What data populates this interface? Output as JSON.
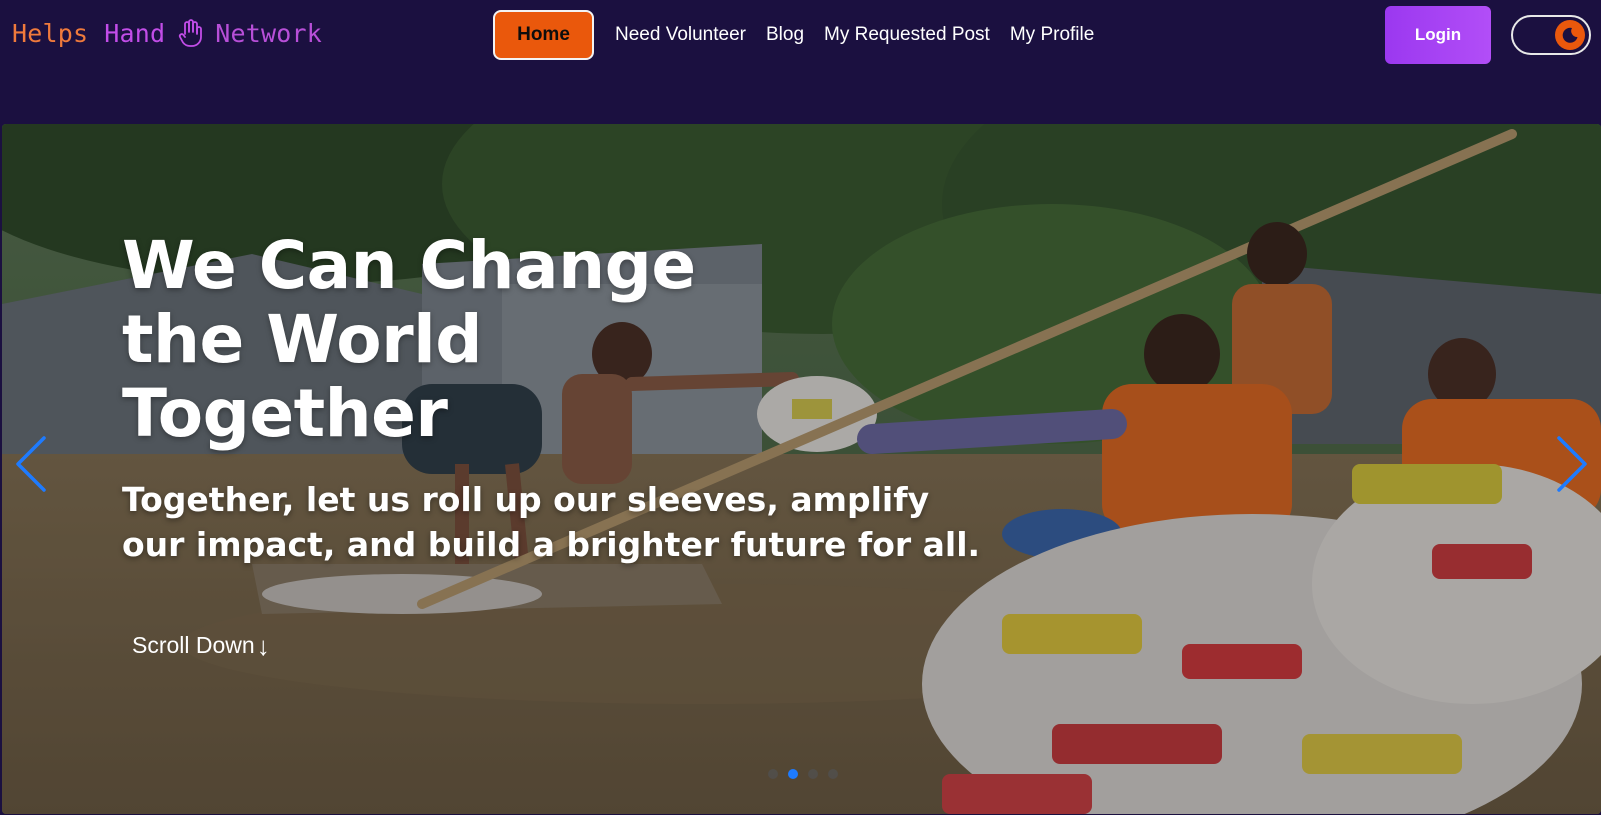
{
  "brand": {
    "word1": "Helps",
    "word2": "Hand",
    "word3": "Network",
    "icon": "hand-icon"
  },
  "nav": {
    "home": "Home",
    "links": [
      "Need Volunteer",
      "Blog",
      "My Requested Post",
      "My Profile"
    ]
  },
  "login": "Login",
  "theme_toggle": {
    "icon": "moon-icon",
    "state": "dark"
  },
  "hero": {
    "title": "We Can Change the World Together",
    "subtitle": "Together, let us roll up our sleeves, amplify our impact, and build a brighter future for all.",
    "scroll_label": "Scroll Down",
    "scroll_icon": "↓",
    "prev_icon": "chevron-left-icon",
    "next_icon": "chevron-right-icon"
  },
  "carousel": {
    "slides": 4,
    "active": 2
  },
  "colors": {
    "background": "#1b1040",
    "accent_orange": "#ea580c",
    "login_purple": "#a142f4",
    "brand_orange": "#ef7a3c",
    "brand_purple": "#c24de8",
    "indicator_blue": "#1e7bff"
  }
}
